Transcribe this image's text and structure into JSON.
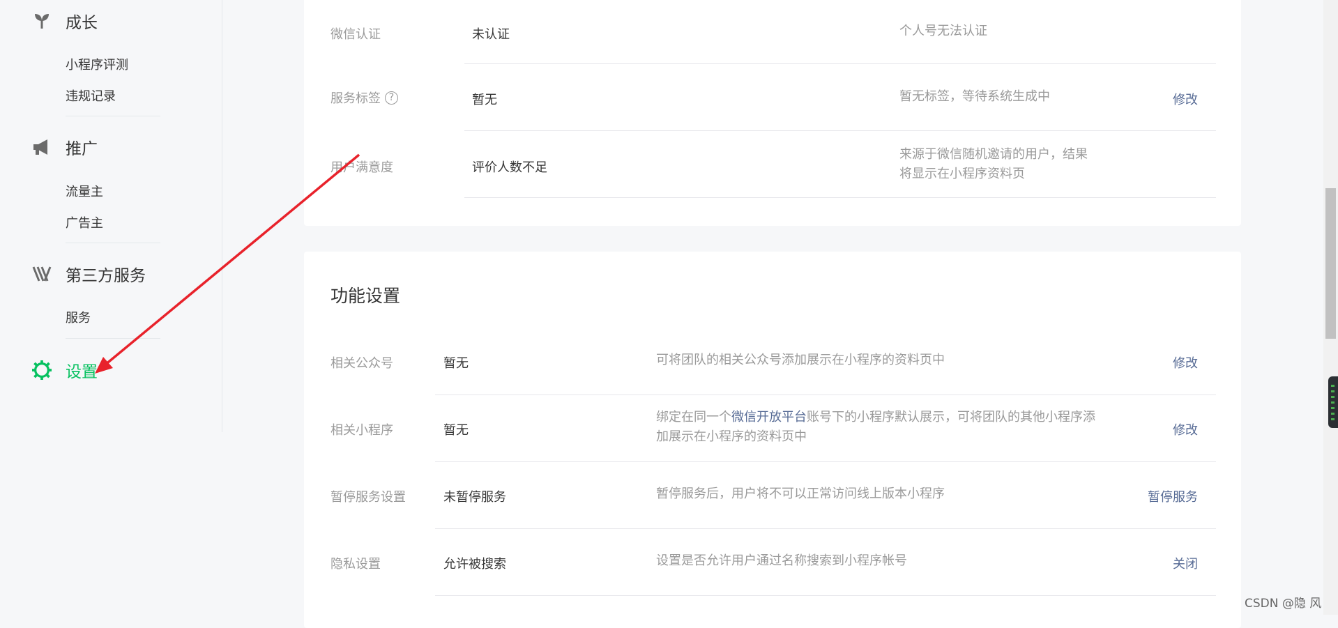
{
  "sidebar": {
    "growth": {
      "icon": "sprout-icon",
      "label": "成长",
      "items": [
        "小程序评测",
        "违规记录"
      ]
    },
    "promotion": {
      "icon": "megaphone-icon",
      "label": "推广",
      "items": [
        "流量主",
        "广告主"
      ]
    },
    "third_party": {
      "icon": "third-party-icon",
      "label": "第三方服务",
      "items": [
        "服务"
      ]
    },
    "settings": {
      "icon": "gear-icon",
      "label": "设置",
      "active": true
    }
  },
  "basic_rows": [
    {
      "label": "微信认证",
      "value": "未认证",
      "desc": "个人号无法认证",
      "action": ""
    },
    {
      "label": "服务标签",
      "value": "暂无",
      "desc": "暂无标签，等待系统生成中",
      "action": "修改",
      "has_help_icon": true
    },
    {
      "label": "用户满意度",
      "value": "评价人数不足",
      "desc_line1": "来源于微信随机邀请的用户，结果",
      "desc_line2": "将显示在小程序资料页",
      "action": ""
    }
  ],
  "function_settings": {
    "title": "功能设置",
    "rows": [
      {
        "label": "相关公众号",
        "value": "暂无",
        "desc": "可将团队的相关公众号添加展示在小程序的资料页中",
        "action": "修改"
      },
      {
        "label": "相关小程序",
        "value": "暂无",
        "desc_prefix": "绑定在同一个",
        "desc_link": "微信开放平台",
        "desc_suffix": "账号下的小程序默认展示，可将团队的其他小程序添",
        "desc_line2": "加展示在小程序的资料页中",
        "action": "修改"
      },
      {
        "label": "暂停服务设置",
        "value": "未暂停服务",
        "desc": "暂停服务后，用户将不可以正常访问线上版本小程序",
        "action": "暂停服务"
      },
      {
        "label": "隐私设置",
        "value": "允许被搜索",
        "desc": "设置是否允许用户通过名称搜索到小程序帐号",
        "action": "关闭"
      }
    ]
  },
  "watermark": "CSDN @隐 风",
  "colors": {
    "accent_green": "#07c160",
    "link_blue": "#576b95",
    "annotation_red": "#e8222b"
  }
}
